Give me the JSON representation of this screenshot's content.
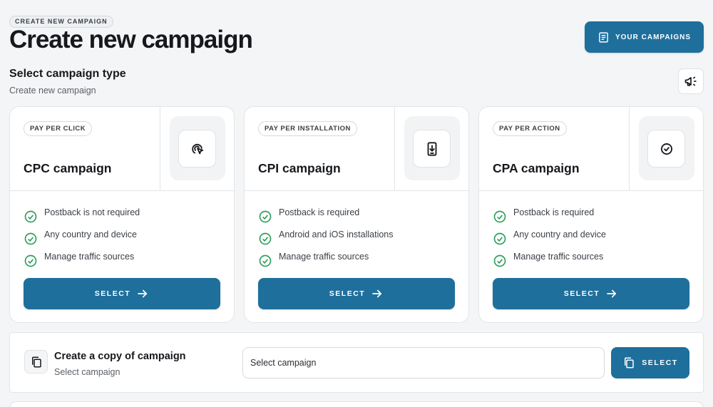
{
  "header": {
    "breadcrumb": "CREATE NEW CAMPAIGN",
    "title": "Create new campaign",
    "your_campaigns_label": "YOUR CAMPAIGNS"
  },
  "section": {
    "title": "Select campaign type",
    "subtitle": "Create new campaign"
  },
  "cards": [
    {
      "chip": "PAY PER CLICK",
      "title": "CPC campaign",
      "icon": "click-cursor-icon",
      "features": [
        "Postback is not required",
        "Any country and device",
        "Manage traffic sources"
      ],
      "select_label": "SELECT"
    },
    {
      "chip": "PAY PER INSTALLATION",
      "title": "CPI campaign",
      "icon": "phone-download-icon",
      "features": [
        "Postback is required",
        "Android and iOS installations",
        "Manage traffic sources"
      ],
      "select_label": "SELECT"
    },
    {
      "chip": "PAY PER ACTION",
      "title": "CPA campaign",
      "icon": "check-circle-icon",
      "features": [
        "Postback is required",
        "Any country and device",
        "Manage traffic sources"
      ],
      "select_label": "SELECT"
    }
  ],
  "copy": {
    "title": "Create a copy of campaign",
    "subtitle": "Select campaign",
    "select_value": "Select campaign",
    "select_label": "SELECT"
  },
  "colors": {
    "accent": "#1f6f9c",
    "check": "#2e9e5b",
    "background": "#f4f5f6"
  }
}
